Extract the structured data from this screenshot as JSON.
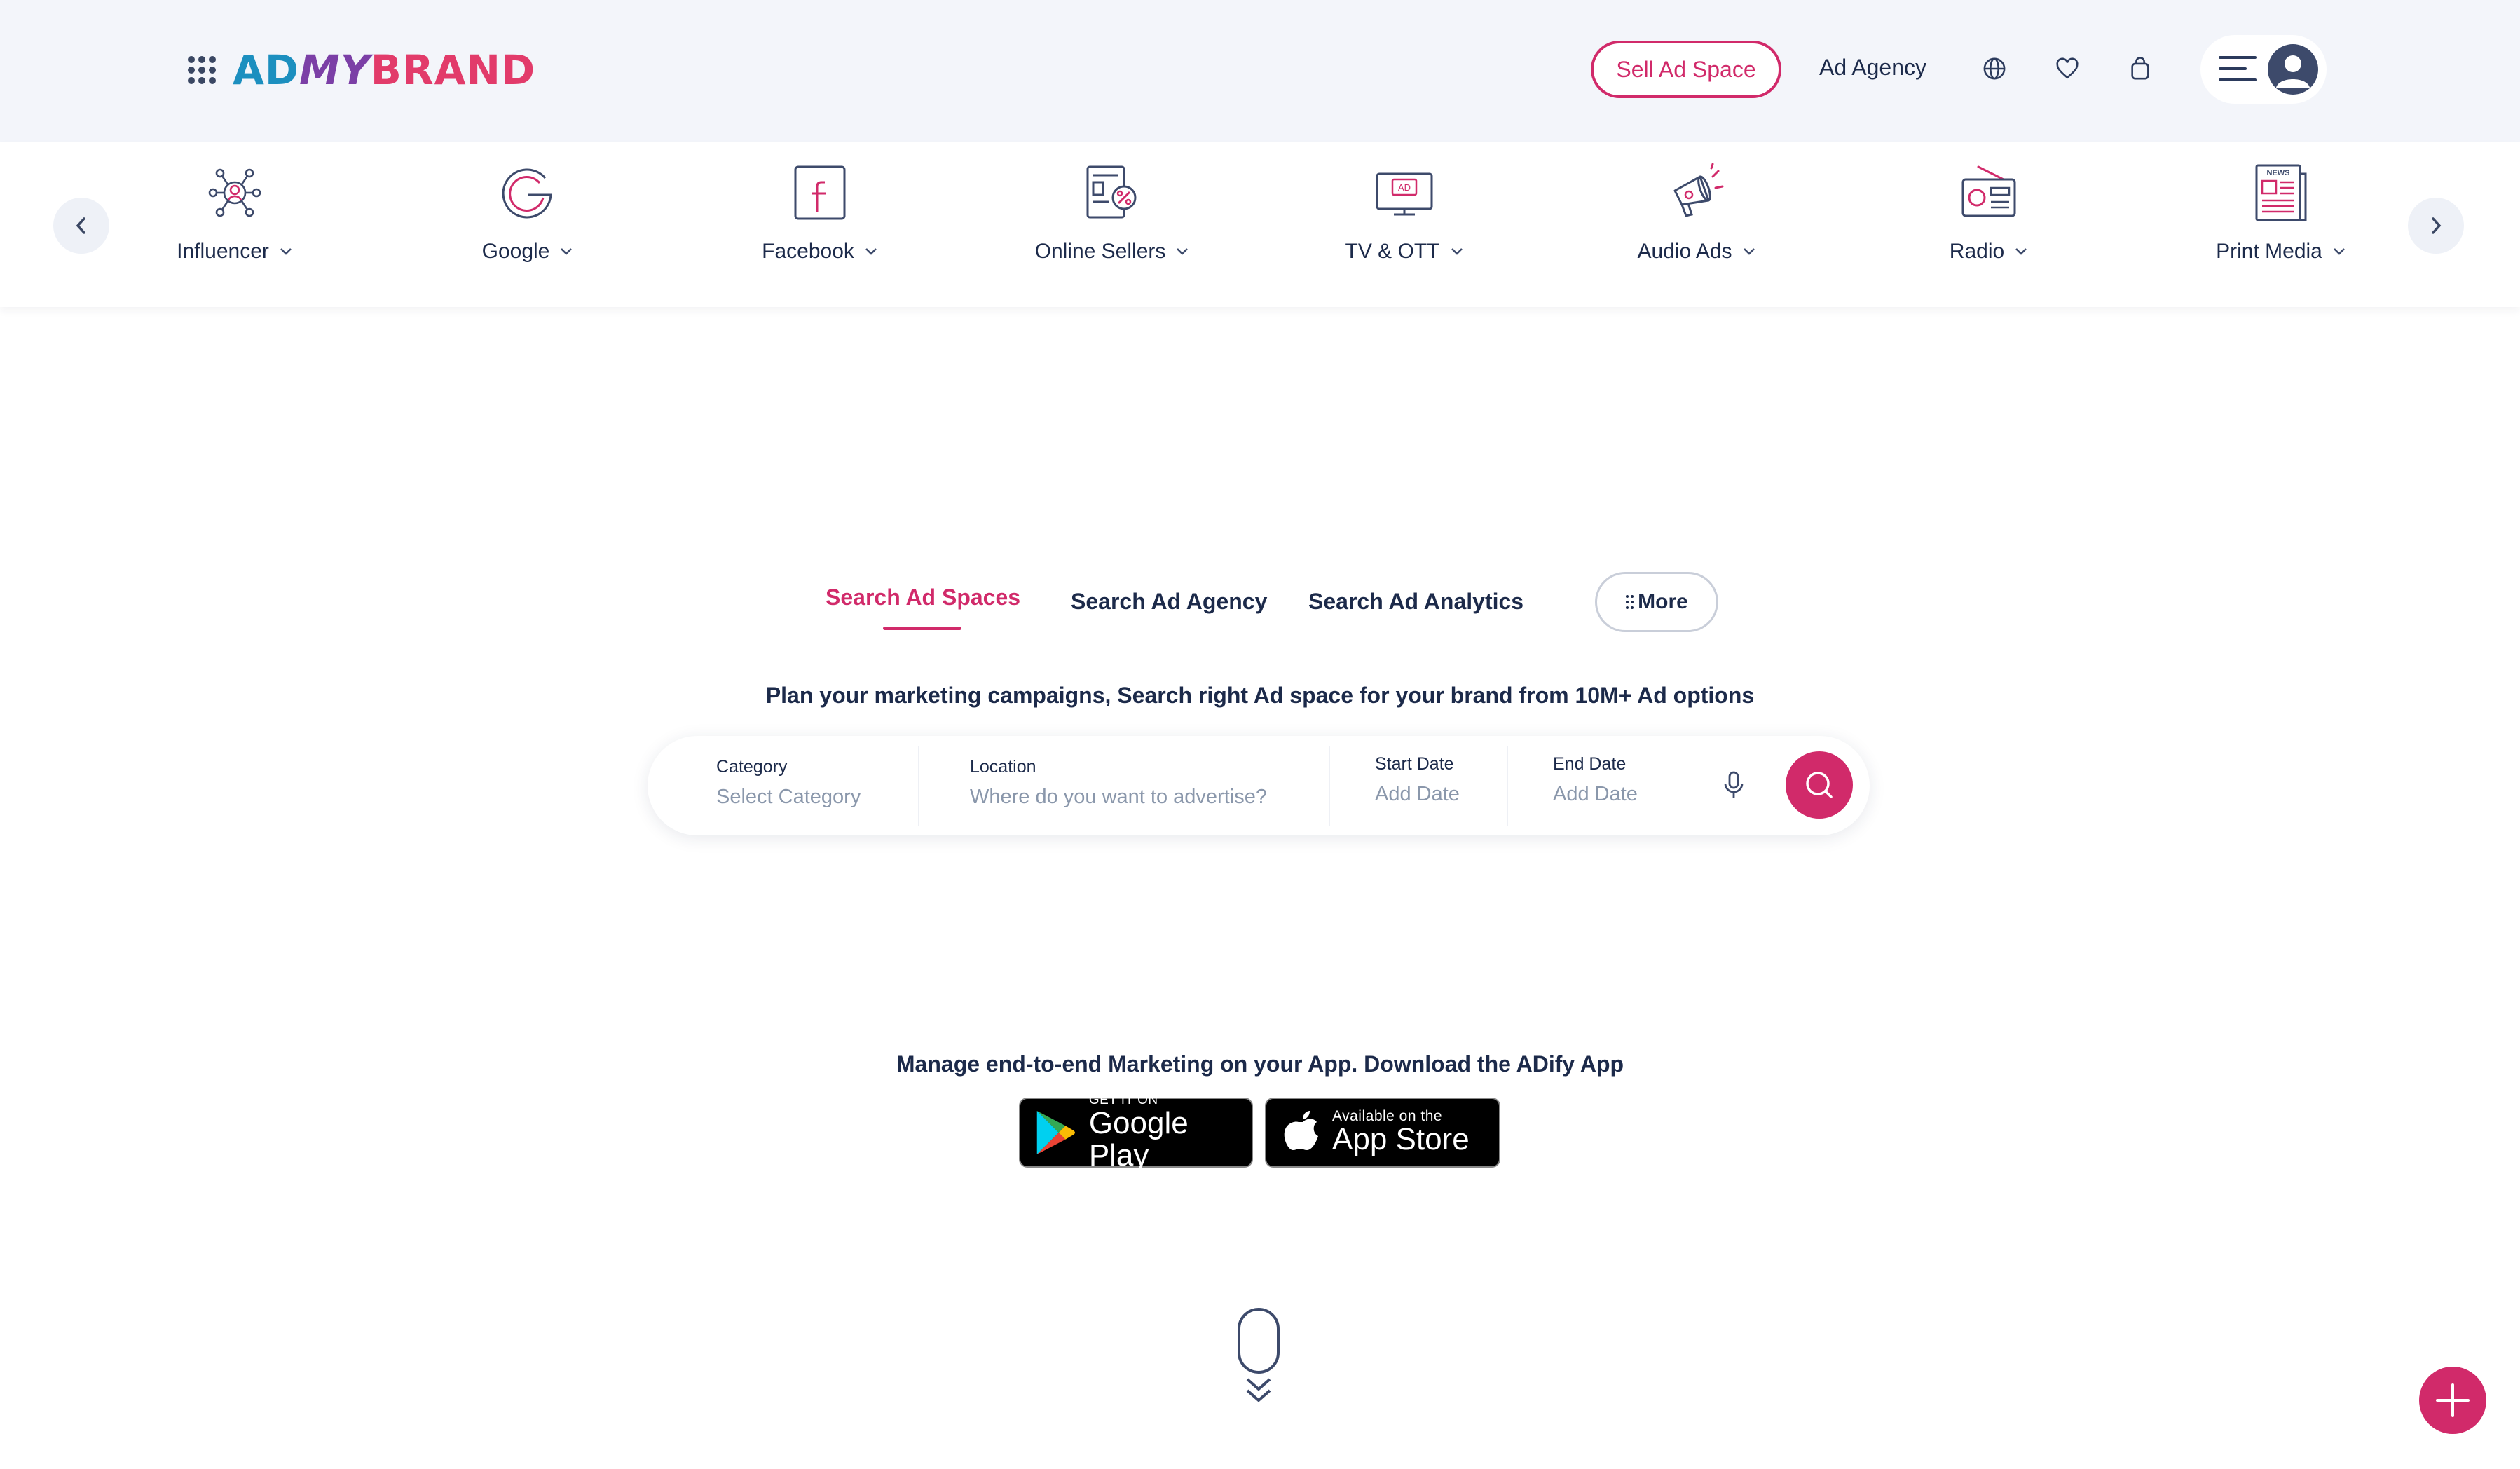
{
  "header": {
    "logo_text_parts": [
      "AD",
      "MY",
      "BRAND"
    ],
    "sell_button": "Sell Ad Space",
    "agency_link": "Ad Agency",
    "icons": [
      "grid-icon",
      "globe-icon",
      "heart-icon",
      "bag-icon",
      "menu-icon",
      "user-avatar-icon"
    ]
  },
  "categories": [
    {
      "label": "Influencer",
      "icon": "influencer-icon"
    },
    {
      "label": "Google",
      "icon": "google-icon"
    },
    {
      "label": "Facebook",
      "icon": "facebook-icon"
    },
    {
      "label": "Online Sellers",
      "icon": "online-sellers-icon"
    },
    {
      "label": "TV & OTT",
      "icon": "tv-icon"
    },
    {
      "label": "Audio Ads",
      "icon": "megaphone-icon"
    },
    {
      "label": "Radio",
      "icon": "radio-icon"
    },
    {
      "label": "Print Media",
      "icon": "newspaper-icon"
    }
  ],
  "search_tabs": {
    "tabs": [
      "Search Ad Spaces",
      "Search Ad Agency",
      "Search Ad Analytics"
    ],
    "active": "Search Ad Spaces",
    "more": "More"
  },
  "tagline": "Plan your marketing campaigns, Search right Ad space for your brand from 10M+ Ad options",
  "search": {
    "category_label": "Category",
    "category_placeholder": "Select Category",
    "location_label": "Location",
    "location_placeholder": "Where do you want to advertise?",
    "start_label": "Start Date",
    "start_placeholder": "Add Date",
    "end_label": "End Date",
    "end_placeholder": "Add Date"
  },
  "app": {
    "text": "Manage end-to-end Marketing on your App. Download the ADify App",
    "google_small": "GET IT ON",
    "google_big": "Google Play",
    "apple_small": "Available on the",
    "apple_big": "App Store"
  },
  "colors": {
    "accent": "#d12a6a",
    "text": "#1c2a4a",
    "header_bg": "#f3f5fa"
  }
}
